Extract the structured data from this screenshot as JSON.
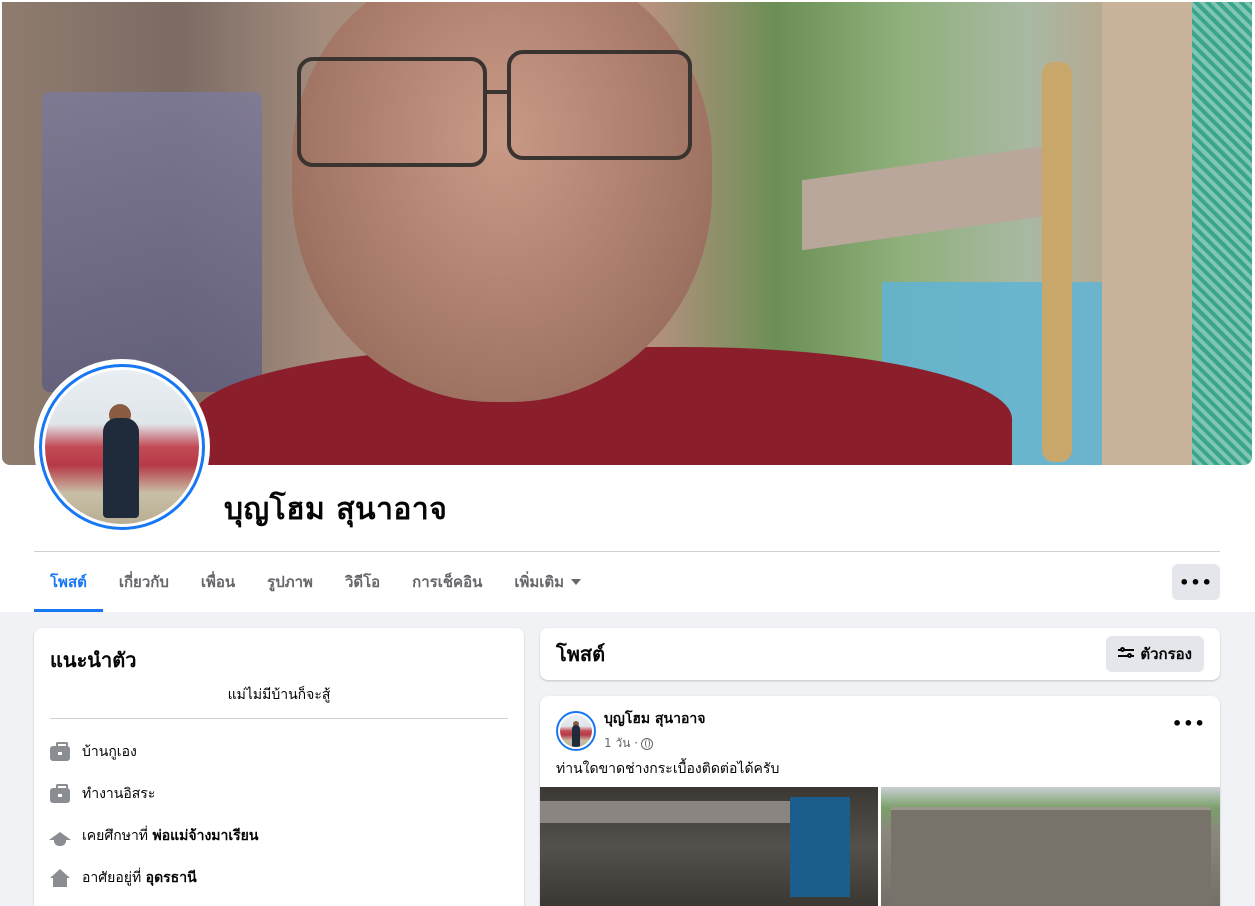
{
  "profile": {
    "name": "บุญโฮม สุนาอาจ"
  },
  "tabs": [
    {
      "label": "โพสต์",
      "active": true
    },
    {
      "label": "เกี่ยวกับ",
      "active": false
    },
    {
      "label": "เพื่อน",
      "active": false
    },
    {
      "label": "รูปภาพ",
      "active": false
    },
    {
      "label": "วิดีโอ",
      "active": false
    },
    {
      "label": "การเช็คอิน",
      "active": false
    },
    {
      "label": "เพิ่มเติม",
      "active": false
    }
  ],
  "more_button": "•••",
  "intro": {
    "title": "แนะนำตัว",
    "bio": "แม่ไม่มีบ้านก็จะสู้",
    "items": [
      {
        "icon": "briefcase-icon",
        "text": "บ้านกูเอง",
        "bold": ""
      },
      {
        "icon": "briefcase-icon",
        "text": "ทำงานอิสระ",
        "bold": ""
      },
      {
        "icon": "graduation-cap-icon",
        "text": "เคยศึกษาที่ ",
        "bold": "พ่อแม่จ้างมาเรียน"
      },
      {
        "icon": "home-icon",
        "text": "อาศัยอยู่ที่ ",
        "bold": "อุดรธานี"
      }
    ]
  },
  "posts_section": {
    "title": "โพสต์",
    "filter_label": "ตัวกรอง"
  },
  "post": {
    "author": "บุญโฮม สุนาอาจ",
    "time": "1 วัน ·",
    "text": "ท่านใดขาดช่างกระเบื้องติดต่อได้ครับ",
    "menu": "•••"
  },
  "colors": {
    "accent": "#1877f2",
    "background": "#f0f2f5",
    "secondary_text": "#65676b"
  }
}
